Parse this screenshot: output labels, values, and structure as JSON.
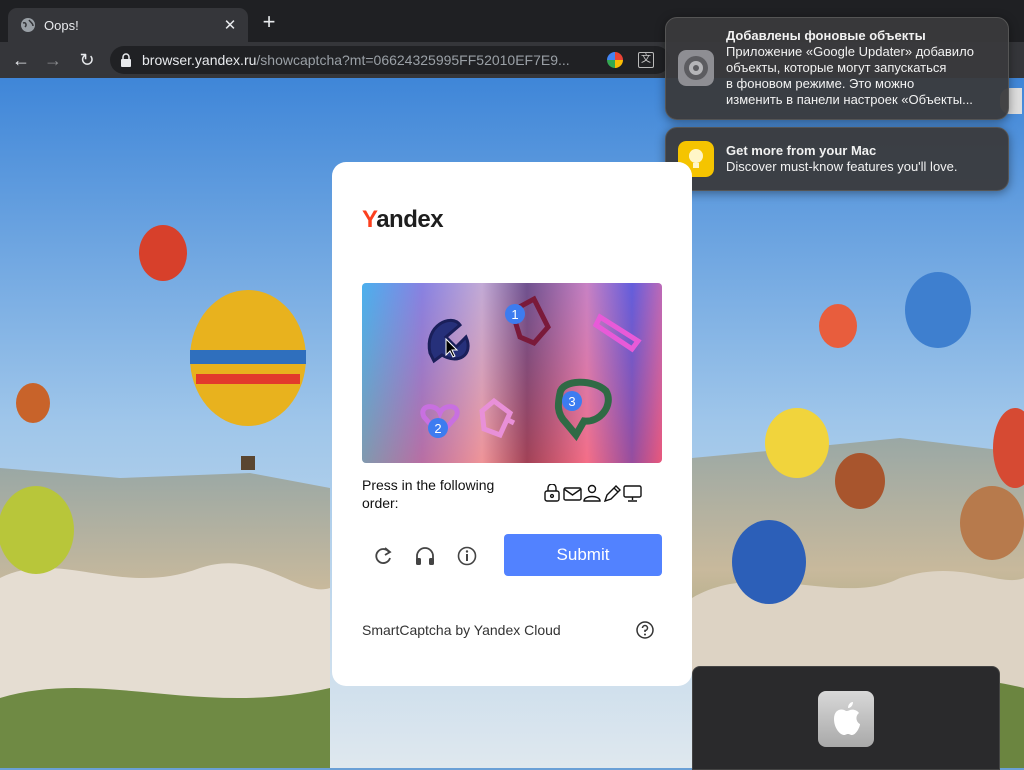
{
  "browser": {
    "tab_title": "Oops!",
    "tab_close": "✕",
    "new_tab": "+",
    "url_host": "browser.yandex.ru",
    "url_path": "/showcaptcha?mt=06624325995FF52010EF7E9..."
  },
  "notifications": [
    {
      "title": "Добавлены фоновые объекты",
      "lines": [
        "Приложение «Google Updater» добавило",
        "объекты, которые могут запускаться",
        "в фоновом режиме. Это можно",
        "изменить в панели настроек «Объекты..."
      ],
      "icon": "settings-gear-icon"
    },
    {
      "title": "Get more from your Mac",
      "lines": [
        "Discover must-know features you'll love."
      ],
      "icon": "lightbulb-icon"
    }
  ],
  "captcha": {
    "logo_y": "Y",
    "logo_rest": "andex",
    "markers": [
      "1",
      "2",
      "3"
    ],
    "instruction": "Press in the following order:",
    "order_icons": [
      "lock-icon",
      "envelope-icon",
      "person-icon",
      "pencil-icon",
      "monitor-icon"
    ],
    "submit_label": "Submit",
    "footer": "SmartCaptcha by Yandex Cloud",
    "colors": {
      "submit": "#5282ff",
      "logo_y": "#fc3f1d"
    }
  }
}
